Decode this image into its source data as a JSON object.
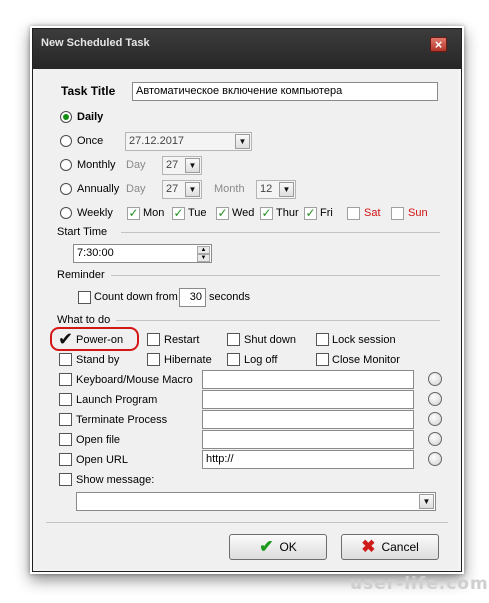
{
  "window": {
    "title": "New Scheduled Task",
    "close_icon": "close-icon"
  },
  "task_title": {
    "label": "Task Title",
    "value": "Автоматическое включение компьютера"
  },
  "schedule": {
    "daily": "Daily",
    "once": "Once",
    "once_date": "27.12.2017",
    "monthly": "Monthly",
    "day_label": "Day",
    "monthly_day": "27",
    "annually": "Annually",
    "annual_day": "27",
    "month_label": "Month",
    "annual_month": "12",
    "weekly": "Weekly",
    "days": {
      "mon": "Mon",
      "tue": "Tue",
      "wed": "Wed",
      "thu": "Thur",
      "fri": "Fri",
      "sat": "Sat",
      "sun": "Sun"
    }
  },
  "start_time": {
    "label": "Start Time",
    "value": "7:30:00"
  },
  "reminder": {
    "label": "Reminder",
    "countdown_label": "Count down from",
    "countdown_value": "30",
    "unit": "seconds"
  },
  "what_to_do": {
    "label": "What to do",
    "power_on": "Power-on",
    "restart": "Restart",
    "shut_down": "Shut down",
    "lock_session": "Lock session",
    "stand_by": "Stand by",
    "hibernate": "Hibernate",
    "log_off": "Log off",
    "close_monitor": "Close Monitor",
    "macro": "Keyboard/Mouse Macro",
    "launch": "Launch Program",
    "terminate": "Terminate Process",
    "open_file": "Open file",
    "open_url": "Open URL",
    "open_url_value": "http://",
    "show_message": "Show message:"
  },
  "buttons": {
    "ok": "OK",
    "cancel": "Cancel"
  },
  "watermark": "user-life.com",
  "colors": {
    "accent_green": "#138d13",
    "weekend_red": "#d21010",
    "highlight_red": "#d41616"
  }
}
